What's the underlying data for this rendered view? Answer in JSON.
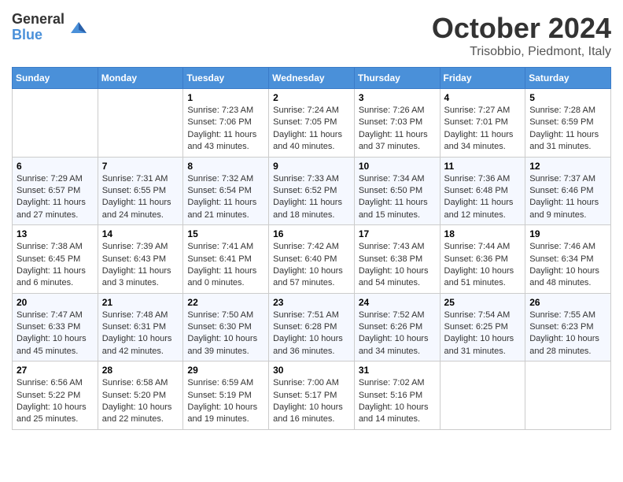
{
  "logo": {
    "general": "General",
    "blue": "Blue"
  },
  "title": "October 2024",
  "location": "Trisobbio, Piedmont, Italy",
  "days_of_week": [
    "Sunday",
    "Monday",
    "Tuesday",
    "Wednesday",
    "Thursday",
    "Friday",
    "Saturday"
  ],
  "weeks": [
    [
      {
        "day": "",
        "sunrise": "",
        "sunset": "",
        "daylight": ""
      },
      {
        "day": "",
        "sunrise": "",
        "sunset": "",
        "daylight": ""
      },
      {
        "day": "1",
        "sunrise": "Sunrise: 7:23 AM",
        "sunset": "Sunset: 7:06 PM",
        "daylight": "Daylight: 11 hours and 43 minutes."
      },
      {
        "day": "2",
        "sunrise": "Sunrise: 7:24 AM",
        "sunset": "Sunset: 7:05 PM",
        "daylight": "Daylight: 11 hours and 40 minutes."
      },
      {
        "day": "3",
        "sunrise": "Sunrise: 7:26 AM",
        "sunset": "Sunset: 7:03 PM",
        "daylight": "Daylight: 11 hours and 37 minutes."
      },
      {
        "day": "4",
        "sunrise": "Sunrise: 7:27 AM",
        "sunset": "Sunset: 7:01 PM",
        "daylight": "Daylight: 11 hours and 34 minutes."
      },
      {
        "day": "5",
        "sunrise": "Sunrise: 7:28 AM",
        "sunset": "Sunset: 6:59 PM",
        "daylight": "Daylight: 11 hours and 31 minutes."
      }
    ],
    [
      {
        "day": "6",
        "sunrise": "Sunrise: 7:29 AM",
        "sunset": "Sunset: 6:57 PM",
        "daylight": "Daylight: 11 hours and 27 minutes."
      },
      {
        "day": "7",
        "sunrise": "Sunrise: 7:31 AM",
        "sunset": "Sunset: 6:55 PM",
        "daylight": "Daylight: 11 hours and 24 minutes."
      },
      {
        "day": "8",
        "sunrise": "Sunrise: 7:32 AM",
        "sunset": "Sunset: 6:54 PM",
        "daylight": "Daylight: 11 hours and 21 minutes."
      },
      {
        "day": "9",
        "sunrise": "Sunrise: 7:33 AM",
        "sunset": "Sunset: 6:52 PM",
        "daylight": "Daylight: 11 hours and 18 minutes."
      },
      {
        "day": "10",
        "sunrise": "Sunrise: 7:34 AM",
        "sunset": "Sunset: 6:50 PM",
        "daylight": "Daylight: 11 hours and 15 minutes."
      },
      {
        "day": "11",
        "sunrise": "Sunrise: 7:36 AM",
        "sunset": "Sunset: 6:48 PM",
        "daylight": "Daylight: 11 hours and 12 minutes."
      },
      {
        "day": "12",
        "sunrise": "Sunrise: 7:37 AM",
        "sunset": "Sunset: 6:46 PM",
        "daylight": "Daylight: 11 hours and 9 minutes."
      }
    ],
    [
      {
        "day": "13",
        "sunrise": "Sunrise: 7:38 AM",
        "sunset": "Sunset: 6:45 PM",
        "daylight": "Daylight: 11 hours and 6 minutes."
      },
      {
        "day": "14",
        "sunrise": "Sunrise: 7:39 AM",
        "sunset": "Sunset: 6:43 PM",
        "daylight": "Daylight: 11 hours and 3 minutes."
      },
      {
        "day": "15",
        "sunrise": "Sunrise: 7:41 AM",
        "sunset": "Sunset: 6:41 PM",
        "daylight": "Daylight: 11 hours and 0 minutes."
      },
      {
        "day": "16",
        "sunrise": "Sunrise: 7:42 AM",
        "sunset": "Sunset: 6:40 PM",
        "daylight": "Daylight: 10 hours and 57 minutes."
      },
      {
        "day": "17",
        "sunrise": "Sunrise: 7:43 AM",
        "sunset": "Sunset: 6:38 PM",
        "daylight": "Daylight: 10 hours and 54 minutes."
      },
      {
        "day": "18",
        "sunrise": "Sunrise: 7:44 AM",
        "sunset": "Sunset: 6:36 PM",
        "daylight": "Daylight: 10 hours and 51 minutes."
      },
      {
        "day": "19",
        "sunrise": "Sunrise: 7:46 AM",
        "sunset": "Sunset: 6:34 PM",
        "daylight": "Daylight: 10 hours and 48 minutes."
      }
    ],
    [
      {
        "day": "20",
        "sunrise": "Sunrise: 7:47 AM",
        "sunset": "Sunset: 6:33 PM",
        "daylight": "Daylight: 10 hours and 45 minutes."
      },
      {
        "day": "21",
        "sunrise": "Sunrise: 7:48 AM",
        "sunset": "Sunset: 6:31 PM",
        "daylight": "Daylight: 10 hours and 42 minutes."
      },
      {
        "day": "22",
        "sunrise": "Sunrise: 7:50 AM",
        "sunset": "Sunset: 6:30 PM",
        "daylight": "Daylight: 10 hours and 39 minutes."
      },
      {
        "day": "23",
        "sunrise": "Sunrise: 7:51 AM",
        "sunset": "Sunset: 6:28 PM",
        "daylight": "Daylight: 10 hours and 36 minutes."
      },
      {
        "day": "24",
        "sunrise": "Sunrise: 7:52 AM",
        "sunset": "Sunset: 6:26 PM",
        "daylight": "Daylight: 10 hours and 34 minutes."
      },
      {
        "day": "25",
        "sunrise": "Sunrise: 7:54 AM",
        "sunset": "Sunset: 6:25 PM",
        "daylight": "Daylight: 10 hours and 31 minutes."
      },
      {
        "day": "26",
        "sunrise": "Sunrise: 7:55 AM",
        "sunset": "Sunset: 6:23 PM",
        "daylight": "Daylight: 10 hours and 28 minutes."
      }
    ],
    [
      {
        "day": "27",
        "sunrise": "Sunrise: 6:56 AM",
        "sunset": "Sunset: 5:22 PM",
        "daylight": "Daylight: 10 hours and 25 minutes."
      },
      {
        "day": "28",
        "sunrise": "Sunrise: 6:58 AM",
        "sunset": "Sunset: 5:20 PM",
        "daylight": "Daylight: 10 hours and 22 minutes."
      },
      {
        "day": "29",
        "sunrise": "Sunrise: 6:59 AM",
        "sunset": "Sunset: 5:19 PM",
        "daylight": "Daylight: 10 hours and 19 minutes."
      },
      {
        "day": "30",
        "sunrise": "Sunrise: 7:00 AM",
        "sunset": "Sunset: 5:17 PM",
        "daylight": "Daylight: 10 hours and 16 minutes."
      },
      {
        "day": "31",
        "sunrise": "Sunrise: 7:02 AM",
        "sunset": "Sunset: 5:16 PM",
        "daylight": "Daylight: 10 hours and 14 minutes."
      },
      {
        "day": "",
        "sunrise": "",
        "sunset": "",
        "daylight": ""
      },
      {
        "day": "",
        "sunrise": "",
        "sunset": "",
        "daylight": ""
      }
    ]
  ]
}
